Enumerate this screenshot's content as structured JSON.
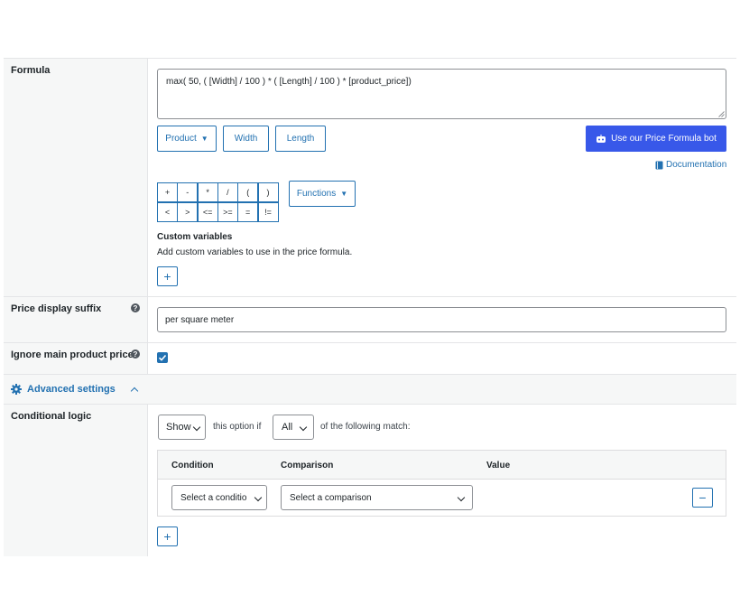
{
  "formula": {
    "label": "Formula",
    "value": "max( 50, ( [Width] / 100 ) * ( [Length] / 100 ) * [product_price])",
    "buttons": {
      "product": "Product",
      "width": "Width",
      "length": "Length"
    },
    "bot_button": "Use our Price Formula bot",
    "documentation": "Documentation",
    "operators_row1": [
      "+",
      "-",
      "*",
      "/",
      "(",
      ")"
    ],
    "operators_row2": [
      "<",
      ">",
      "<=",
      ">=",
      "=",
      "!="
    ],
    "functions": "Functions",
    "custom_vars_title": "Custom variables",
    "custom_vars_desc": "Add custom variables to use in the price formula.",
    "add_symbol": "+"
  },
  "suffix": {
    "label": "Price display suffix",
    "value": "per square meter"
  },
  "ignore": {
    "label": "Ignore main product price",
    "checked": true
  },
  "advanced": {
    "label": "Advanced settings"
  },
  "conditional": {
    "label": "Conditional logic",
    "show_select": "Show",
    "this_option_if": "this option if",
    "all_select": "All",
    "following": "of the following match:",
    "headers": {
      "condition": "Condition",
      "comparison": "Comparison",
      "value": "Value"
    },
    "condition_placeholder": "Select a conditio",
    "comparison_placeholder": "Select a comparison",
    "remove_symbol": "−",
    "add_symbol": "+"
  },
  "colors": {
    "accent": "#2271b1",
    "bot_button_bg": "#3858e9",
    "label_bg": "#f6f7f7",
    "border": "#e4e5e7"
  }
}
